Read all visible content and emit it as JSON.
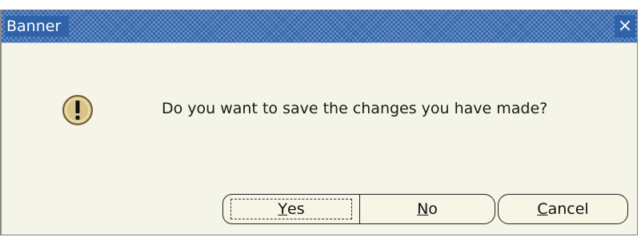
{
  "window": {
    "title": "Banner",
    "close_glyph": "×"
  },
  "dialog": {
    "icon": "warning-exclamation-icon",
    "message": "Do you want to save the changes you have made?"
  },
  "buttons": {
    "yes": {
      "mnemonic": "Y",
      "rest": "es"
    },
    "no": {
      "mnemonic": "N",
      "rest": "o"
    },
    "cancel": {
      "mnemonic": "C",
      "rest": "ancel"
    }
  },
  "colors": {
    "titlebar": "#2f63a9",
    "dialog_bg": "#f5f4e8",
    "icon_fill": "#d9c48a"
  }
}
